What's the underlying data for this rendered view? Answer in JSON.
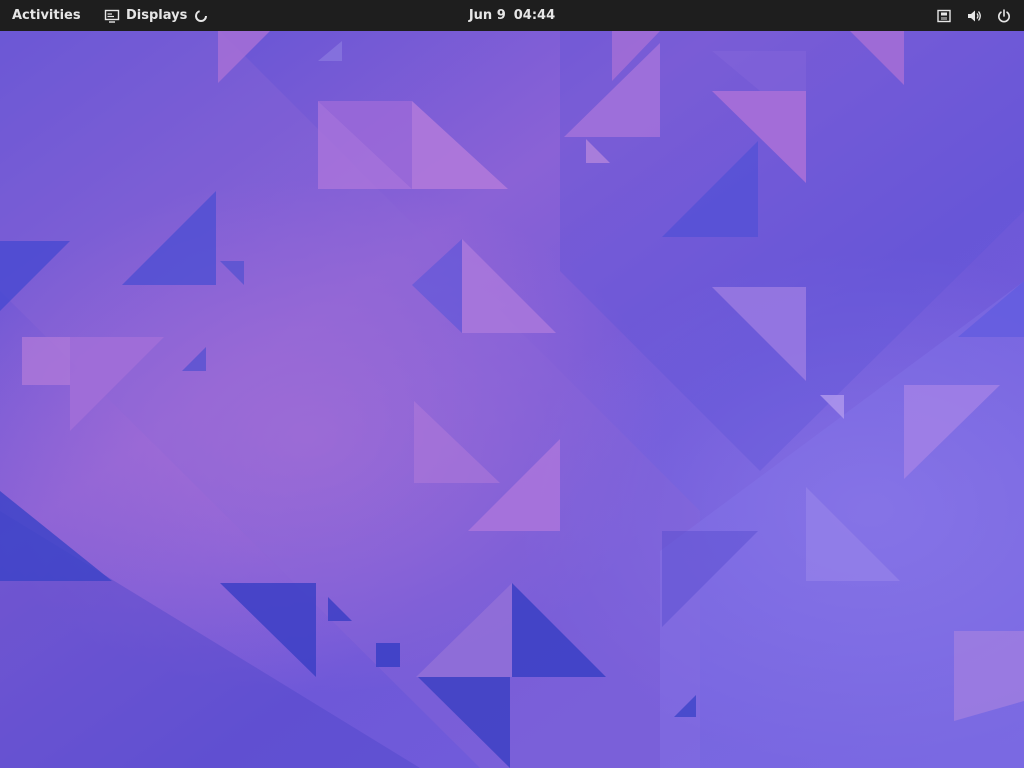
{
  "topbar": {
    "activities_label": "Activities",
    "app_menu": {
      "label": "Displays",
      "icon": "display-settings-icon",
      "loading_indicator": "spinner-icon"
    },
    "clock": {
      "date": "Jun 9",
      "time": "04:44"
    },
    "status_icons": [
      "network-wired-icon",
      "volume-icon",
      "power-icon"
    ]
  },
  "wallpaper": {
    "base_color": "#6a5ad8",
    "accent_colors": [
      "#4a4bd6",
      "#8f66d9",
      "#a46fd8",
      "#7b6ae2",
      "#3e42c8"
    ]
  }
}
